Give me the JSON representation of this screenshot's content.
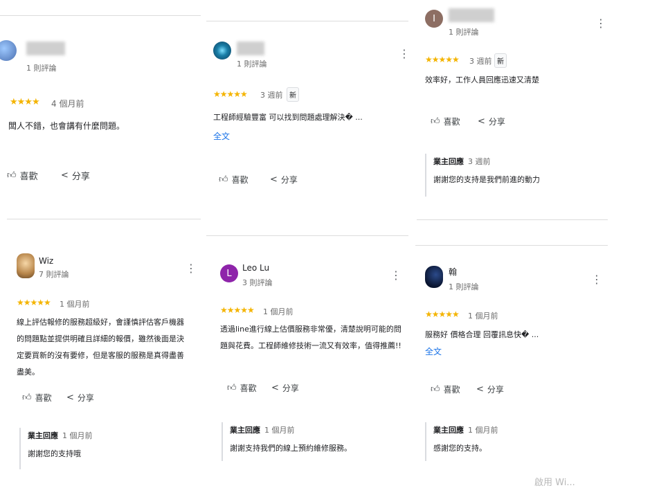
{
  "reviews": [
    {
      "name": "",
      "count": "1 則評論",
      "time": "4 個月前",
      "stars": "★★★★",
      "text": "闆人不錯，也會講有什麼問題。",
      "like": "喜歡",
      "share": "分享"
    },
    {
      "name": "",
      "count": "1 則評論",
      "time": "3 週前",
      "stars": "★★★★★",
      "new": "新",
      "text": "工程師經驗豐富 可以找到問題處理解決� ...",
      "more": "全文",
      "like": "喜歡",
      "share": "分享"
    },
    {
      "name": "",
      "count": "1 則評論",
      "time": "3 週前",
      "stars": "★★★★★",
      "new": "新",
      "text": "效率好，工作人員回應迅速又清楚",
      "like": "喜歡",
      "share": "分享",
      "reply": {
        "title": "業主回應",
        "time": "3 週前",
        "text": "謝謝您的支持是我們前進的動力"
      }
    },
    {
      "name": "Wiz",
      "count": "7 則評論",
      "time": "1 個月前",
      "stars": "★★★★★",
      "text": "線上評估報修的服務超級好，會謹慎評估客戶機器的問題點並提供明確且詳細的報價，雖然後面是決定要買新的沒有要修，但是客服的服務是真得盡善盡美。",
      "like": "喜歡",
      "share": "分享",
      "reply": {
        "title": "業主回應",
        "time": "1 個月前",
        "text": "謝謝您的支持哦"
      }
    },
    {
      "name": "Leo Lu",
      "count": "3 則評論",
      "time": "1 個月前",
      "stars": "★★★★★",
      "text": "透過line進行線上估價服務非常優，清楚說明可能的問題與花費。工程師維修技術一流又有效率，值得推薦!!",
      "like": "喜歡",
      "share": "分享",
      "reply": {
        "title": "業主回應",
        "time": "1 個月前",
        "text": "謝謝支持我們的線上預約維修服務。"
      }
    },
    {
      "name": "翰",
      "count": "1 則評論",
      "time": "1 個月前",
      "stars": "★★★★★",
      "text": "服務好 價格合理 回覆訊息快� ...",
      "more": "全文",
      "like": "喜歡",
      "share": "分享",
      "reply": {
        "title": "業主回應",
        "time": "1 個月前",
        "text": "感謝您的支持。"
      }
    }
  ],
  "avatars": {
    "leo": "L",
    "colors": {
      "leo": "#8e24aa",
      "third": "#8d6e63"
    }
  },
  "watermark": "啟用 Wi..."
}
